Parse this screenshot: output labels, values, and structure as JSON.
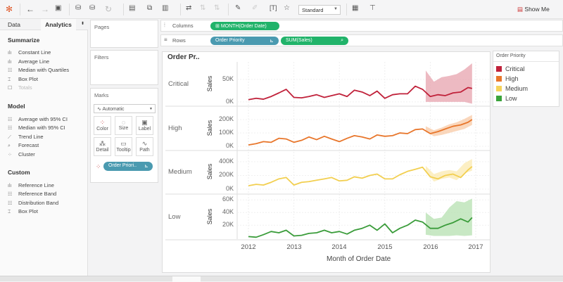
{
  "toolbar": {
    "view_mode": "Standard",
    "show_me": "Show Me",
    "icons": [
      "tableau-logo-icon",
      "back-icon",
      "forward-icon",
      "save-icon",
      "new-datasource-icon",
      "pause-icon",
      "refresh-icon",
      "new-sheet-icon",
      "duplicate-icon",
      "clear-icon",
      "swap-icon",
      "sort-asc-icon",
      "sort-desc-icon",
      "highlight-icon",
      "annotate-icon",
      "label-icon",
      "pin-icon",
      "cards-icon",
      "presentation-icon"
    ]
  },
  "left_panel": {
    "tabs": [
      "Data",
      "Analytics"
    ],
    "summarize": {
      "title": "Summarize",
      "items": [
        "Constant Line",
        "Average Line",
        "Median with Quartiles",
        "Box Plot",
        "Totals"
      ]
    },
    "model": {
      "title": "Model",
      "items": [
        "Average with 95% CI",
        "Median with 95% CI",
        "Trend Line",
        "Forecast",
        "Cluster"
      ]
    },
    "custom": {
      "title": "Custom",
      "items": [
        "Reference Line",
        "Reference Band",
        "Distribution Band",
        "Box Plot"
      ]
    }
  },
  "cards": {
    "pages": "Pages",
    "filters": "Filters",
    "marks": "Marks",
    "mark_type": "Automatic",
    "buttons": [
      "Color",
      "Size",
      "Label",
      "Detail",
      "Tooltip",
      "Path"
    ],
    "color_pill": "Order Priori.."
  },
  "shelves": {
    "columns_label": "Columns",
    "columns_pill": "MONTH(Order Date)",
    "rows_label": "Rows",
    "rows_pills": [
      "Order Priority",
      "SUM(Sales)"
    ]
  },
  "legend": {
    "title": "Order Priority",
    "items": [
      {
        "label": "Critical",
        "color": "#c0213a"
      },
      {
        "label": "High",
        "color": "#e8762b"
      },
      {
        "label": "Medium",
        "color": "#f5d25a"
      },
      {
        "label": "Low",
        "color": "#3aa33a"
      }
    ]
  },
  "chart_data": {
    "type": "line",
    "header": "Order Pr..",
    "xlabel": "Month of Order Date",
    "ylabel": "Sales",
    "x_ticks": [
      "2012",
      "2013",
      "2014",
      "2015",
      "2016",
      "2017"
    ],
    "xlim": [
      2012,
      2017
    ],
    "x": [
      2012.0,
      2012.17,
      2012.33,
      2012.5,
      2012.67,
      2012.83,
      2013.0,
      2013.17,
      2013.33,
      2013.5,
      2013.67,
      2013.83,
      2014.0,
      2014.17,
      2014.33,
      2014.5,
      2014.67,
      2014.83,
      2015.0,
      2015.17,
      2015.33,
      2015.5,
      2015.67,
      2015.83,
      2016.0,
      2016.17,
      2016.33,
      2016.5,
      2016.67,
      2016.83,
      2016.92
    ],
    "forecast_x": [
      2015.9,
      2016.08,
      2016.25,
      2016.42,
      2016.58,
      2016.75,
      2016.92
    ],
    "panels": [
      {
        "name": "Critical",
        "color": "#c0213a",
        "band_color": "#e7a3ae",
        "ylim": [
          -8000,
          86000
        ],
        "ticks": [
          "50K",
          "0K"
        ],
        "tick_values": [
          50000,
          0
        ],
        "values": [
          5000,
          8000,
          6000,
          12000,
          20000,
          28000,
          10000,
          9000,
          12000,
          16000,
          10000,
          14000,
          18000,
          12000,
          26000,
          22000,
          14000,
          24000,
          8000,
          16000,
          18000,
          18000,
          35000,
          28000,
          12000,
          16000,
          14000,
          20000,
          22000,
          32000,
          30000
        ],
        "band_low": [
          0,
          0,
          0,
          0,
          0,
          0,
          -4000
        ],
        "band_high": [
          70000,
          45000,
          55000,
          58000,
          62000,
          72000,
          90000
        ]
      },
      {
        "name": "High",
        "color": "#e8762b",
        "band_color": "#f8c9a5",
        "ylim": [
          -26000,
          295000
        ],
        "ticks": [
          "200K",
          "100K",
          "0K"
        ],
        "tick_values": [
          200000,
          100000,
          0
        ],
        "values": [
          10000,
          20000,
          35000,
          30000,
          60000,
          55000,
          30000,
          45000,
          70000,
          50000,
          75000,
          55000,
          35000,
          60000,
          80000,
          70000,
          55000,
          85000,
          75000,
          80000,
          100000,
          95000,
          125000,
          130000,
          95000,
          110000,
          130000,
          150000,
          160000,
          180000,
          200000
        ],
        "band_low": [
          110000,
          75000,
          85000,
          100000,
          115000,
          130000,
          160000
        ],
        "band_high": [
          150000,
          120000,
          140000,
          165000,
          180000,
          205000,
          235000
        ]
      },
      {
        "name": "Medium",
        "color": "#f2cf50",
        "band_color": "#fbeab0",
        "ylim": [
          -62000,
          554000
        ],
        "ticks": [
          "400K",
          "200K",
          "0K"
        ],
        "tick_values": [
          400000,
          200000,
          0
        ],
        "values": [
          50000,
          70000,
          60000,
          100000,
          150000,
          170000,
          60000,
          100000,
          110000,
          130000,
          150000,
          170000,
          120000,
          130000,
          180000,
          160000,
          200000,
          220000,
          150000,
          150000,
          210000,
          260000,
          290000,
          320000,
          180000,
          150000,
          200000,
          220000,
          170000,
          280000,
          330000
        ],
        "band_low": [
          260000,
          110000,
          150000,
          170000,
          130000,
          230000,
          270000
        ],
        "band_high": [
          340000,
          220000,
          260000,
          280000,
          260000,
          380000,
          440000
        ]
      },
      {
        "name": "Low",
        "color": "#3a9c3a",
        "band_color": "#b5e0b0",
        "ylim": [
          -2000,
          68000
        ],
        "ticks": [
          "60K",
          "40K",
          "20K"
        ],
        "tick_values": [
          60000,
          40000,
          20000
        ],
        "values": [
          2000,
          1000,
          5000,
          10000,
          8000,
          12000,
          3000,
          4000,
          7000,
          8000,
          12000,
          8000,
          10000,
          6000,
          12000,
          15000,
          20000,
          12000,
          22000,
          8000,
          15000,
          20000,
          28000,
          25000,
          15000,
          15000,
          20000,
          24000,
          30000,
          25000,
          32000
        ],
        "band_low": [
          5000,
          3000,
          3000,
          3000,
          4000,
          3000,
          4000
        ],
        "band_high": [
          40000,
          30000,
          32000,
          48000,
          58000,
          56000,
          62000
        ]
      }
    ]
  }
}
